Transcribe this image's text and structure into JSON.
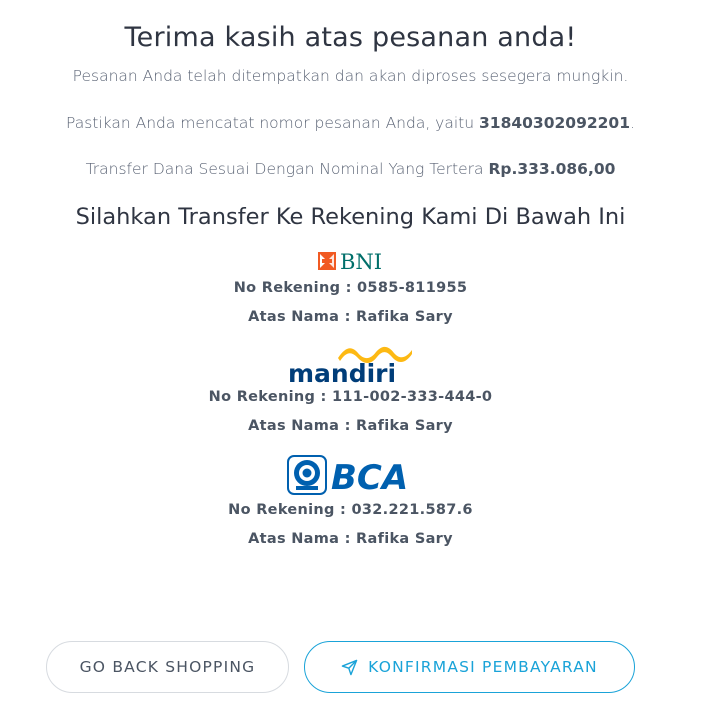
{
  "header": {
    "title": "Terima kasih atas pesanan anda!",
    "subtitle": "Pesanan Anda telah ditempatkan dan akan diproses sesegera mungkin."
  },
  "order": {
    "note_prefix": "Pastikan Anda mencatat nomor pesanan Anda, yaitu ",
    "order_number": "31840302092201",
    "note_suffix": "."
  },
  "transfer": {
    "text_prefix": "Transfer Dana Sesuai Dengan Nominal Yang Tertera ",
    "amount": "Rp.333.086,00"
  },
  "banks_heading": "Silahkan Transfer Ke Rekening Kami Di Bawah Ini",
  "banks": [
    {
      "logo_text": "BNI",
      "icon": "bni-logo",
      "account_label": "No Rekening : ",
      "account_number": "0585-811955",
      "name_label": "Atas Nama : ",
      "account_name": "Rafika Sary",
      "brand_color": "#006f6a",
      "accent_color": "#f15a23"
    },
    {
      "logo_text": "mandiri",
      "icon": "mandiri-logo",
      "account_label": "No Rekening : ",
      "account_number": "111-002-333-444-0",
      "name_label": "Atas Nama : ",
      "account_name": "Rafika Sary",
      "brand_color": "#003d79",
      "accent_color": "#fdb913"
    },
    {
      "logo_text": "BCA",
      "icon": "bca-logo",
      "account_label": "No Rekening : ",
      "account_number": "032.221.587.6",
      "name_label": "Atas Nama : ",
      "account_name": "Rafika Sary",
      "brand_color": "#0060af"
    }
  ],
  "buttons": {
    "back_label": "GO BACK SHOPPING",
    "confirm_label": "KONFIRMASI PEMBAYARAN",
    "confirm_icon": "send-icon",
    "accent_color": "#1aa3d8"
  }
}
